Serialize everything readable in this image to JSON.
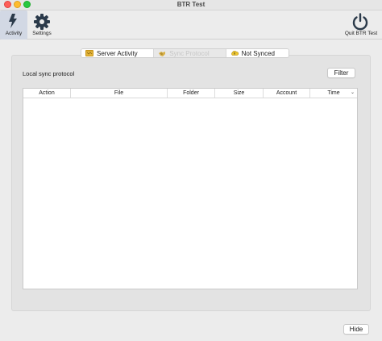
{
  "window": {
    "title": "BTR Test"
  },
  "toolbar": {
    "activity_label": "Activity",
    "settings_label": "Settings",
    "quit_label": "Quit BTR Test"
  },
  "tabs": [
    {
      "label": "Server Activity",
      "icon": "folder-icon",
      "state": "normal"
    },
    {
      "label": "Sync Protocol",
      "icon": "handshake-icon",
      "state": "selected"
    },
    {
      "label": "Not Synced",
      "icon": "warning-cloud-icon",
      "state": "normal"
    }
  ],
  "main": {
    "section_label": "Local sync protocol",
    "filter_label": "Filter",
    "hide_label": "Hide"
  },
  "table": {
    "columns": [
      "Action",
      "File",
      "Folder",
      "Size",
      "Account",
      "Time"
    ],
    "sort_icon": "chevron-down-icon",
    "rows": []
  },
  "colors": {
    "accent_selected": "#d2d8e4",
    "icon_dark": "#2b3a4a"
  }
}
